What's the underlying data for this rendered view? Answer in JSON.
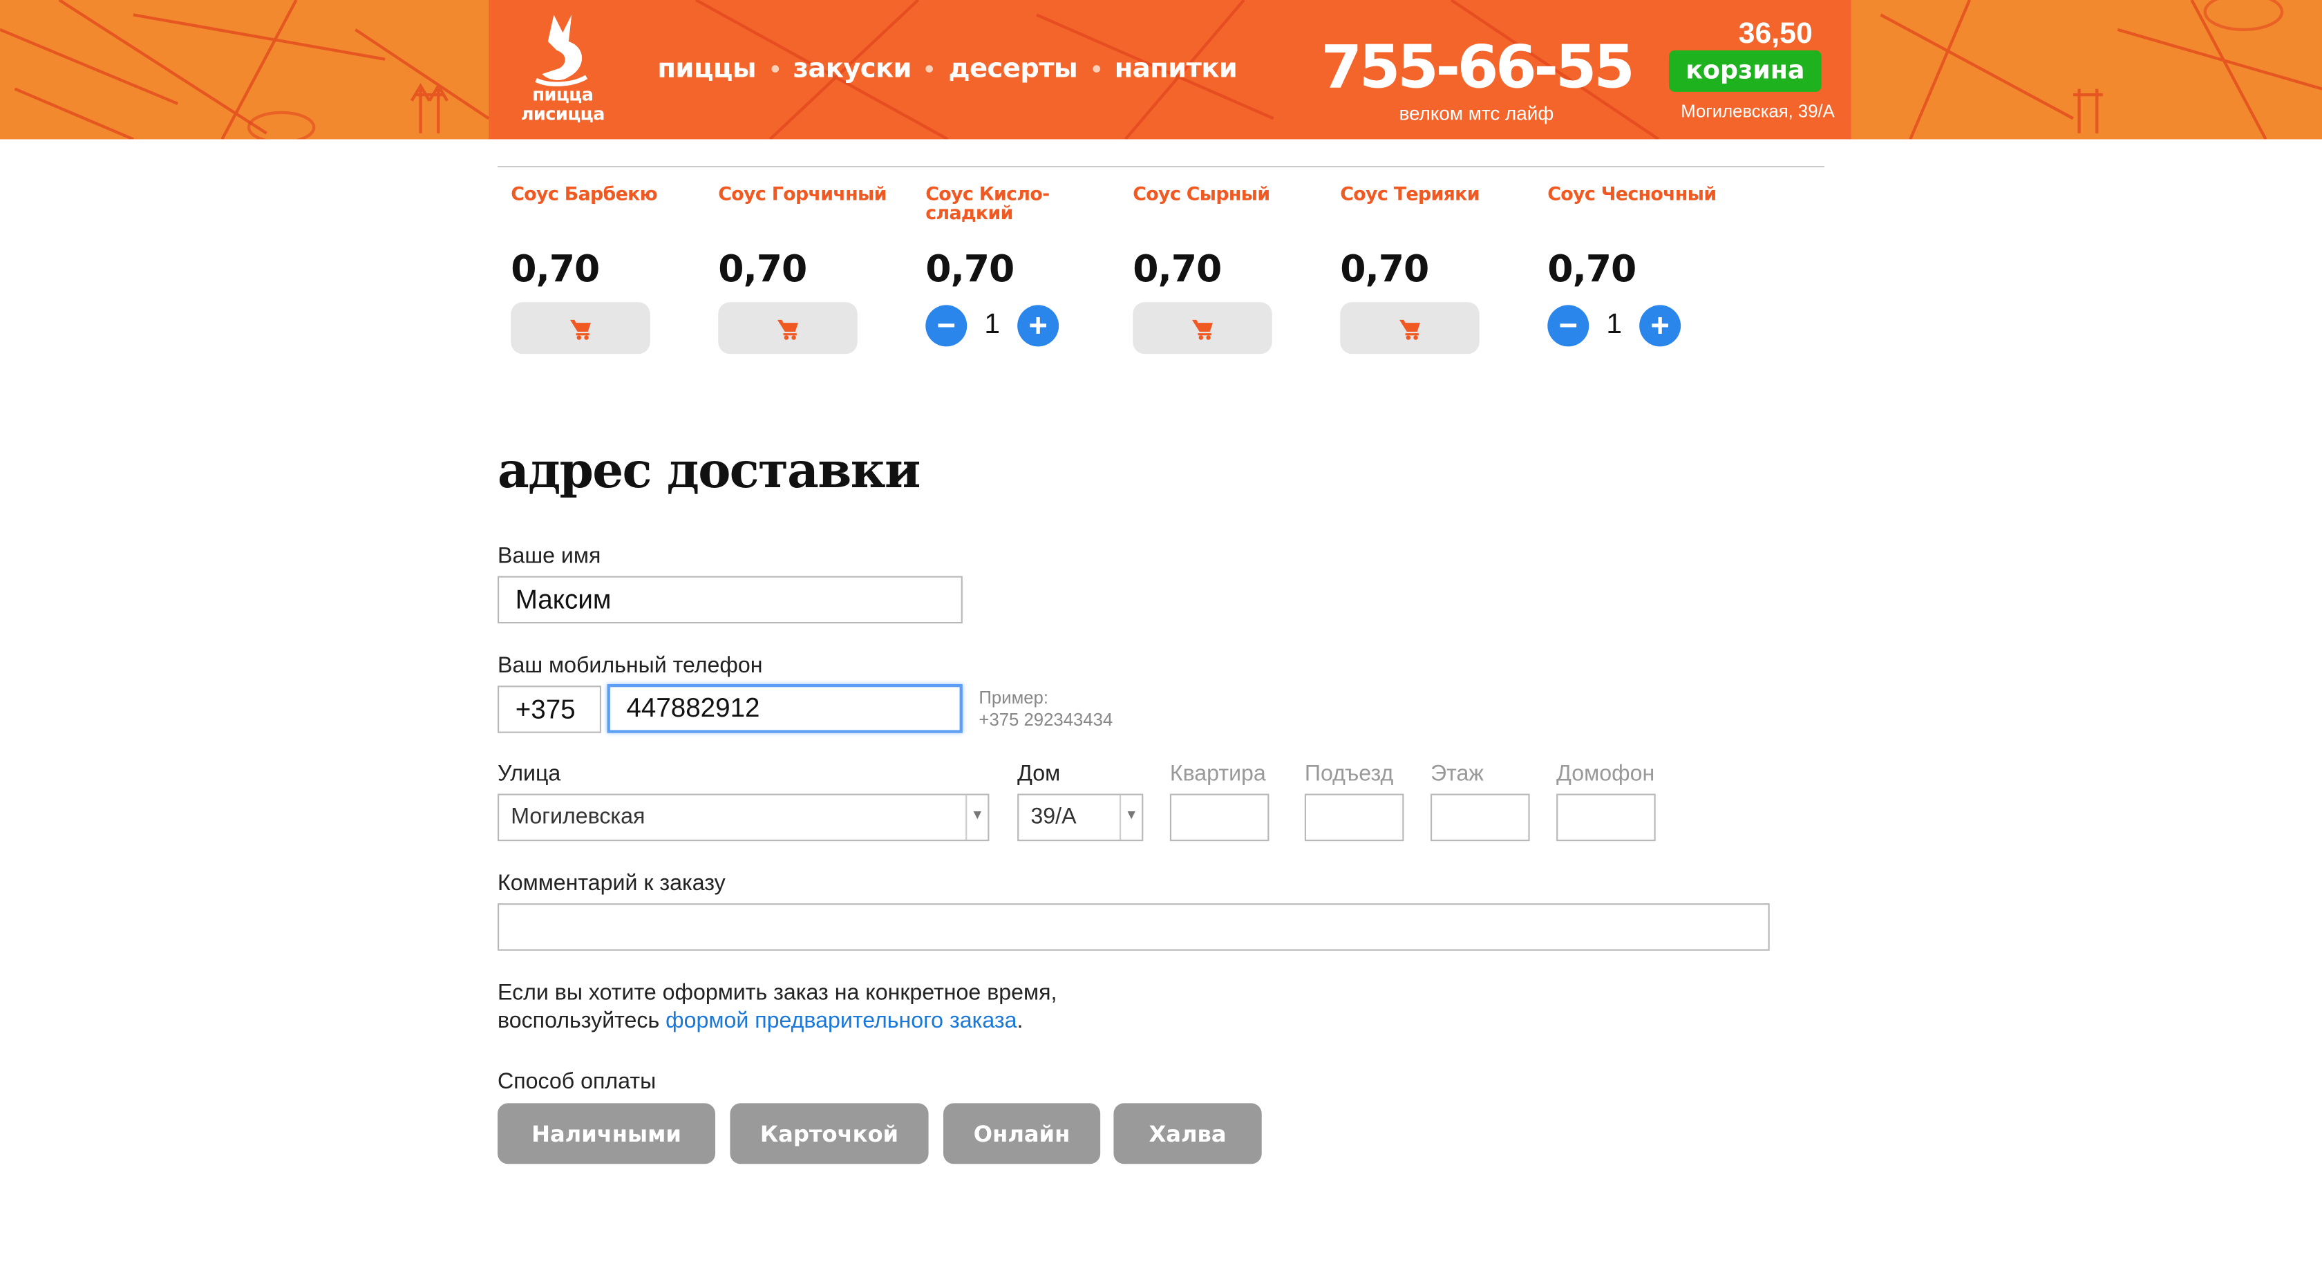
{
  "header": {
    "logo_lines": [
      "пицца",
      "лисицца"
    ],
    "nav": [
      "пиццы",
      "закуски",
      "десерты",
      "напитки"
    ],
    "phone": "755-66-55",
    "phone_sub": "велком мтс лайф",
    "cart_sum": "36,50",
    "cart_label": "корзина",
    "address": "Могилевская, 39/А"
  },
  "sauces": [
    {
      "name": "Соус Барбекю",
      "price": "0,70",
      "qty": null
    },
    {
      "name": "Соус Горчичный",
      "price": "0,70",
      "qty": null
    },
    {
      "name": "Соус Кисло-сладкий",
      "price": "0,70",
      "qty": "1"
    },
    {
      "name": "Соус Сырный",
      "price": "0,70",
      "qty": null
    },
    {
      "name": "Соус Терияки",
      "price": "0,70",
      "qty": null
    },
    {
      "name": "Соус Чесночный",
      "price": "0,70",
      "qty": "1"
    }
  ],
  "form": {
    "title": "адрес доставки",
    "name_label": "Ваше имя",
    "name_value": "Максим",
    "phone_label": "Ваш мобильный телефон",
    "phone_code": "+375",
    "phone_value": "447882912",
    "hint_line1": "Пример:",
    "hint_line2": "+375 292343434",
    "street_label": "Улица",
    "street_value": "Могилевская",
    "house_label": "Дом",
    "house_value": "39/А",
    "apt_label": "Квартира",
    "entrance_label": "Подъезд",
    "floor_label": "Этаж",
    "intercom_label": "Домофон",
    "comment_label": "Комментарий к заказу",
    "note_line1": "Если вы хотите оформить заказ на конкретное время,",
    "note_line2_start": "воспользуйтесь ",
    "note_link": "формой предварительного заказа",
    "note_line2_end": ".",
    "payment_label": "Способ оплаты",
    "payments": [
      "Наличными",
      "Карточкой",
      "Онлайн",
      "Халва"
    ]
  },
  "colors": {
    "brand": "#f4652b",
    "cart": "#1eb21e",
    "qty_button": "#2b86ec",
    "sauce_name": "#f05a22",
    "link": "#1a78d8",
    "payment_button": "#9a9a9a"
  },
  "icons": {
    "add_to_cart": "cart-icon",
    "minus": "minus-icon",
    "plus": "plus-icon",
    "dropdown": "dropdown-arrow-icon"
  }
}
